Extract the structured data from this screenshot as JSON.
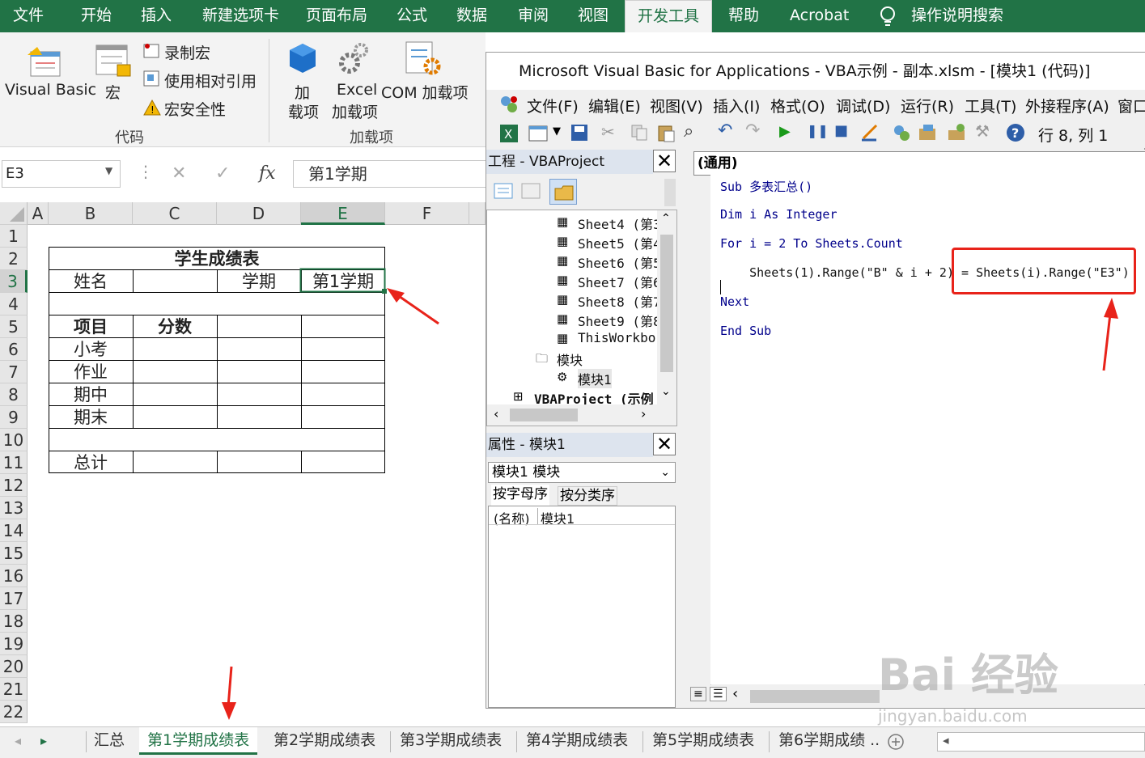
{
  "ribbon_tabs": [
    "文件",
    "开始",
    "插入",
    "新建选项卡",
    "页面布局",
    "公式",
    "数据",
    "审阅",
    "视图",
    "开发工具",
    "帮助",
    "Acrobat",
    "操作说明搜索"
  ],
  "ribbon": {
    "visual_basic": "Visual Basic",
    "macros": "宏",
    "record_macro": "录制宏",
    "relative_ref": "使用相对引用",
    "macro_security": "宏安全性",
    "group_code": "代码",
    "addins_1": "加",
    "addins_2": "载项",
    "excel_addins_1": "Excel",
    "excel_addins_2": "加载项",
    "com_addins": "COM 加载项",
    "group_addins": "加载项"
  },
  "formula_bar": {
    "name_box": "E3",
    "fx": "fx",
    "value": "第1学期"
  },
  "columns": [
    "A",
    "B",
    "C",
    "D",
    "E",
    "F"
  ],
  "rows": [
    "1",
    "2",
    "3",
    "4",
    "5",
    "6",
    "7",
    "8",
    "9",
    "10",
    "11",
    "12",
    "13",
    "14",
    "15",
    "16",
    "17",
    "18",
    "19",
    "20",
    "21",
    "22"
  ],
  "table": {
    "title": "学生成绩表",
    "name_label": "姓名",
    "term_label": "学期",
    "term_value": "第1学期",
    "item_header": "项目",
    "score_header": "分数",
    "items": [
      "小考",
      "作业",
      "期中",
      "期末"
    ],
    "total": "总计"
  },
  "sheet_tabs": [
    "汇总",
    "第1学期成绩表",
    "第2学期成绩表",
    "第3学期成绩表",
    "第4学期成绩表",
    "第5学期成绩表",
    "第6学期成绩 ..."
  ],
  "vba": {
    "title": "Microsoft Visual Basic for Applications - VBA示例 - 副本.xlsm - [模块1 (代码)]",
    "menu": [
      "文件(F)",
      "编辑(E)",
      "视图(V)",
      "插入(I)",
      "格式(O)",
      "调试(D)",
      "运行(R)",
      "工具(T)",
      "外接程序(A)",
      "窗口"
    ],
    "position": "行 8, 列 1",
    "project_title": "工程 - VBAProject",
    "tree": [
      "Sheet4 (第3",
      "Sheet5 (第4",
      "Sheet6 (第5",
      "Sheet7 (第6",
      "Sheet8 (第7",
      "Sheet9 (第8",
      "ThisWorkbo",
      "模块",
      "模块1",
      "VBAProject (示例"
    ],
    "props_title": "属性 - 模块1",
    "props_select": "模块1 模块",
    "props_tabs": [
      "按字母序",
      "按分类序"
    ],
    "props_row_key": "(名称)",
    "props_row_val": "模块1",
    "code_dropdown": "(通用)",
    "code": [
      "Sub 多表汇总()",
      "Dim i As Integer",
      "For i = 2 To Sheets.Count",
      "    Sheets(1).Range(\"B\" & i + 2) = Sheets(i).Range(\"E3\")",
      "Next",
      "End Sub"
    ]
  },
  "watermark": {
    "main": "Bai 经验",
    "sub": "jingyan.baidu.com"
  },
  "colors": {
    "excel_green": "#217346",
    "highlight_red": "#e8231a",
    "vba_blue": "#00008b"
  }
}
